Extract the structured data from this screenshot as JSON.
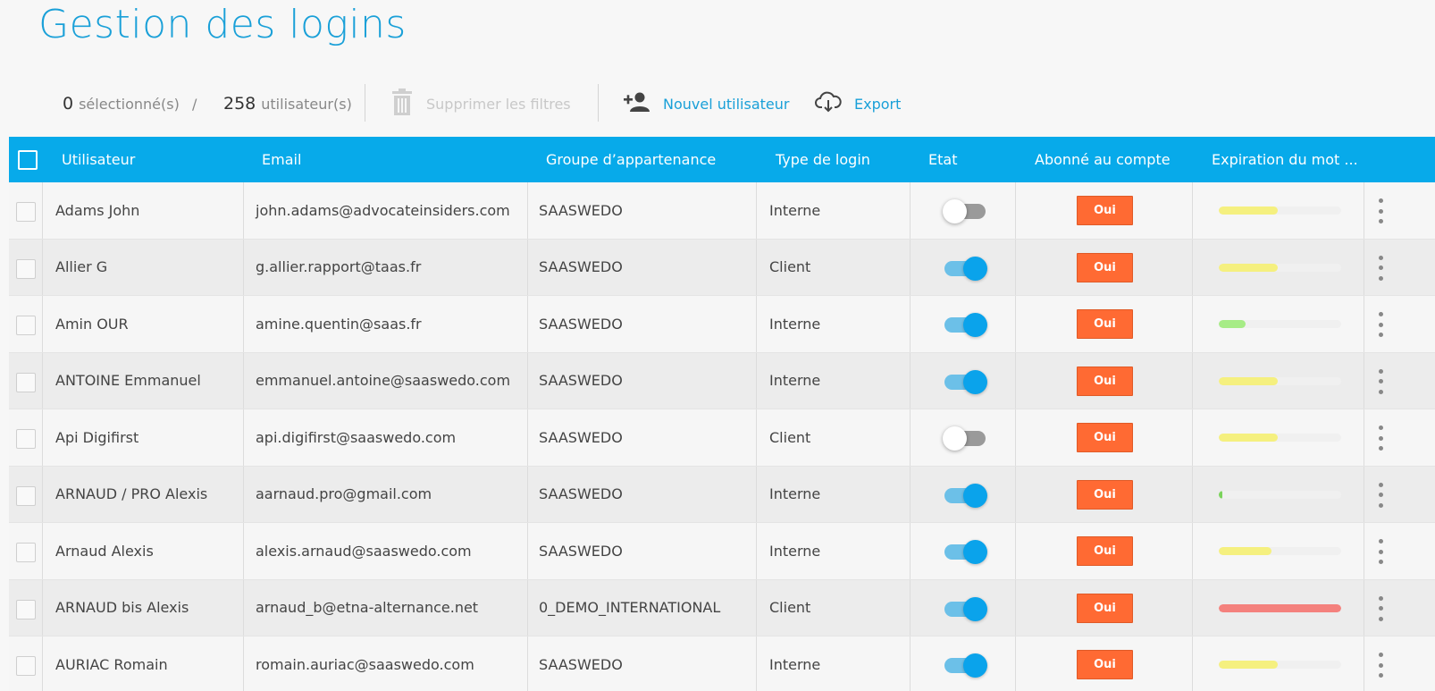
{
  "page": {
    "title": "Gestion des logins"
  },
  "toolbar": {
    "selected_count": "0",
    "selected_label": "sélectionné(s)",
    "separator": "/",
    "total_count": "258",
    "total_label": "utilisateur(s)",
    "clear_filters_label": "Supprimer les filtres",
    "new_user_label": "Nouvel utilisateur",
    "export_label": "Export"
  },
  "table": {
    "headers": {
      "user": "Utilisateur",
      "email": "Email",
      "group": "Groupe d’appartenance",
      "login_type": "Type de login",
      "state": "Etat",
      "subscribed": "Abonné au compte",
      "expiration": "Expiration du mot ..."
    },
    "rows": [
      {
        "user": "Adams John",
        "email": "john.adams@advocateinsiders.com",
        "group": "SAASWEDO",
        "login_type": "Interne",
        "active": false,
        "subscribed": "Oui",
        "expiration": 0.48,
        "expiration_color": "#f5f07f"
      },
      {
        "user": "Allier G",
        "email": "g.allier.rapport@taas.fr",
        "group": "SAASWEDO",
        "login_type": "Client",
        "active": true,
        "subscribed": "Oui",
        "expiration": 0.48,
        "expiration_color": "#f5f07f"
      },
      {
        "user": "Amin OUR",
        "email": "amine.quentin@saas.fr",
        "group": "SAASWEDO",
        "login_type": "Interne",
        "active": true,
        "subscribed": "Oui",
        "expiration": 0.22,
        "expiration_color": "#a6ec86"
      },
      {
        "user": "ANTOINE Emmanuel",
        "email": "emmanuel.antoine@saaswedo.com",
        "group": "SAASWEDO",
        "login_type": "Interne",
        "active": true,
        "subscribed": "Oui",
        "expiration": 0.48,
        "expiration_color": "#f5f07f"
      },
      {
        "user": "Api Digifirst",
        "email": "api.digifirst@saaswedo.com",
        "group": "SAASWEDO",
        "login_type": "Client",
        "active": false,
        "subscribed": "Oui",
        "expiration": 0.48,
        "expiration_color": "#f5f07f"
      },
      {
        "user": "ARNAUD / PRO Alexis",
        "email": "aarnaud.pro@gmail.com",
        "group": "SAASWEDO",
        "login_type": "Interne",
        "active": true,
        "subscribed": "Oui",
        "expiration": 0.03,
        "expiration_color": "#7bd35c"
      },
      {
        "user": "Arnaud Alexis",
        "email": "alexis.arnaud@saaswedo.com",
        "group": "SAASWEDO",
        "login_type": "Interne",
        "active": true,
        "subscribed": "Oui",
        "expiration": 0.43,
        "expiration_color": "#f5f07f"
      },
      {
        "user": "ARNAUD bis Alexis",
        "email": "arnaud_b@etna-alternance.net",
        "group": "0_DEMO_INTERNATIONAL",
        "login_type": "Client",
        "active": true,
        "subscribed": "Oui",
        "expiration": 1.0,
        "expiration_color": "#f4817d"
      },
      {
        "user": "AURIAC Romain",
        "email": "romain.auriac@saaswedo.com",
        "group": "SAASWEDO",
        "login_type": "Interne",
        "active": true,
        "subscribed": "Oui",
        "expiration": 0.48,
        "expiration_color": "#f5f07f"
      }
    ]
  },
  "icons": {
    "trash": "trash-icon",
    "add_user": "add-user-icon",
    "export": "cloud-download-icon",
    "menu": "kebab-menu-icon"
  },
  "colors": {
    "accent": "#1aa0d8",
    "header_bg": "#07aaea",
    "badge": "#ff6a33"
  }
}
